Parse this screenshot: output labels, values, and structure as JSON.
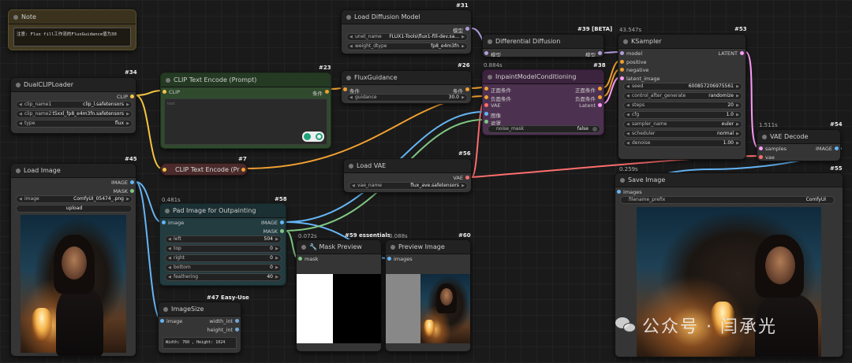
{
  "colors": {
    "clip": "#f5c542",
    "conditioning": "#f0a030",
    "model": "#b39ddb",
    "vae": "#ff6e6e",
    "latent": "#ff9cf9",
    "image": "#64b5f6",
    "mask": "#81c784",
    "int": "#6fa8dc"
  },
  "note": {
    "title": "Note",
    "text": "注意: Flux fill工作流的FluxGuidance值为30"
  },
  "dualclip": {
    "id": "#34",
    "title": "DualCLIPLoader",
    "out_clip": "CLIP",
    "w1_label": "clip_name1",
    "w1_value": "clip_l.safetensors",
    "w2_label": "clip_name2",
    "w2_value": "t5xxl_fp8_e4m3fn.safetensors",
    "w3_label": "type",
    "w3_value": "flux"
  },
  "clip_pos": {
    "id": "#23",
    "title": "CLIP Text Encode (Prompt)",
    "in_clip": "CLIP",
    "out": "条件",
    "placeholder": "text"
  },
  "clip_neg": {
    "id": "#7",
    "title": "CLIP Text Encode (Pr"
  },
  "load_diffusion": {
    "id": "#31",
    "title": "Load Diffusion Model",
    "out": "模型",
    "w1_label": "unet_name",
    "w1_value": "FLUX1-Tools\\flux1-fill-dev.sa...",
    "w2_label": "weight_dtype",
    "w2_value": "fp8_e4m3fn"
  },
  "flux_guidance": {
    "id": "#26",
    "title": "FluxGuidance",
    "in": "条件",
    "out": "条件",
    "w1_label": "guidance",
    "w1_value": "30.0"
  },
  "diff_diffusion": {
    "id": "#39 [BETA]",
    "title": "Differential Diffusion",
    "in": "模型",
    "out": "模型"
  },
  "inpaint_cond": {
    "id": "#38",
    "timing": "0.884s",
    "title": "InpaintModelConditioning",
    "in_pos": "正面条件",
    "in_neg": "负面条件",
    "in_vae": "VAE",
    "in_img": "图像",
    "in_mask": "遮罩",
    "out_pos": "正面条件",
    "out_neg": "负面条件",
    "out_latent": "Latent",
    "w1_label": "noise_mask",
    "w1_value": "false"
  },
  "ksampler": {
    "id": "#53",
    "timing": "43.547s",
    "title": "KSampler",
    "in_model": "model",
    "in_pos": "positive",
    "in_neg": "negative",
    "in_latent": "latent_image",
    "out": "LATENT",
    "widgets": [
      {
        "label": "seed",
        "value": "600857206975561"
      },
      {
        "label": "control_after_generate",
        "value": "randomize"
      },
      {
        "label": "steps",
        "value": "20"
      },
      {
        "label": "cfg",
        "value": "1.0"
      },
      {
        "label": "sampler_name",
        "value": "euler"
      },
      {
        "label": "scheduler",
        "value": "normal"
      },
      {
        "label": "denoise",
        "value": "1.00"
      }
    ]
  },
  "vae_decode": {
    "id": "#54",
    "timing": "1.511s",
    "title": "VAE Decode",
    "in_samples": "samples",
    "in_vae": "vae",
    "out": "IMAGE"
  },
  "load_vae": {
    "id": "#56",
    "title": "Load VAE",
    "out": "VAE",
    "w1_label": "vae_name",
    "w1_value": "flux_ave.safetensors"
  },
  "save_image": {
    "id": "#55",
    "timing": "0.259s",
    "title": "Save Image",
    "in": "images",
    "w1_label": "filename_prefix",
    "w1_value": "ComfyUI"
  },
  "load_image": {
    "id": "#45",
    "title": "Load Image",
    "out_image": "IMAGE",
    "out_mask": "MASK",
    "w1_label": "image",
    "w1_value": "ComfyUI_05474_.png",
    "upload": "upload"
  },
  "pad_image": {
    "id": "#58",
    "timing": "0.481s",
    "title": "Pad Image for Outpainting",
    "in": "image",
    "out_image": "IMAGE",
    "out_mask": "MASK",
    "widgets": [
      {
        "label": "left",
        "value": "504"
      },
      {
        "label": "top",
        "value": "0"
      },
      {
        "label": "right",
        "value": "0"
      },
      {
        "label": "bottom",
        "value": "0"
      },
      {
        "label": "feathering",
        "value": "40"
      }
    ]
  },
  "image_size": {
    "id": "#47 Easy-Use",
    "title": "ImageSize",
    "in": "image",
    "out_w": "width_int",
    "out_h": "height_int",
    "text": "Width: 760 , Height: 1024"
  },
  "mask_preview": {
    "id": "#59 essentials",
    "timing": "0.072s",
    "title": "Mask Preview",
    "in": "mask"
  },
  "preview_image": {
    "id": "#60",
    "timing": "0.088s",
    "title": "Preview Image",
    "in": "images"
  },
  "watermark": {
    "text": "公众号 · 闫承光"
  }
}
